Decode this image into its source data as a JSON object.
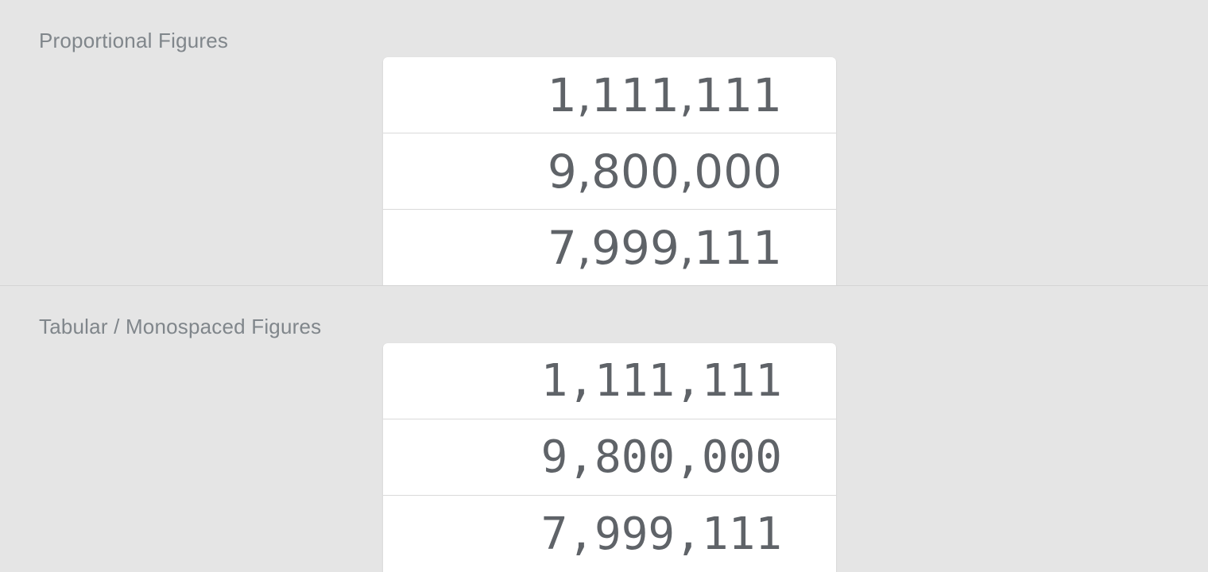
{
  "sections": [
    {
      "label": "Proportional Figures",
      "values": [
        "1,111,111",
        "9,800,000",
        "7,999,111"
      ]
    },
    {
      "label": "Tabular / Monospaced Figures",
      "values": [
        "1,111,111",
        "9,800,000",
        "7,999,111"
      ]
    }
  ]
}
